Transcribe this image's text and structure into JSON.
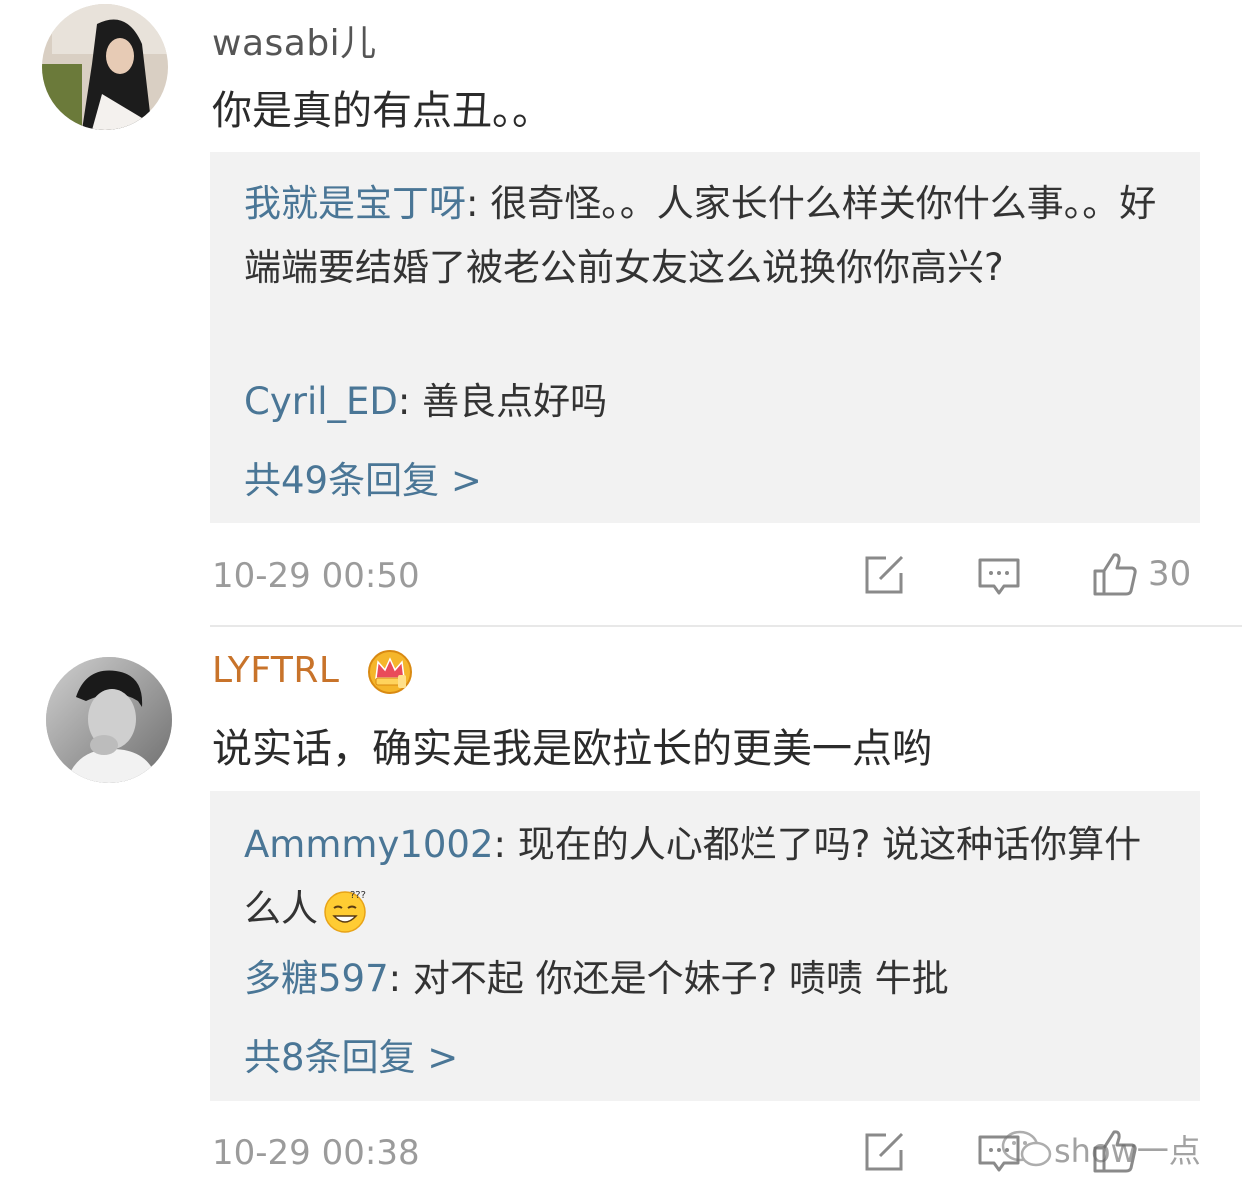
{
  "comments": [
    {
      "username": "wasabi儿",
      "text": "你是真的有点丑。。",
      "avatar_icon": "avatar-woman-photo",
      "replies": [
        {
          "name": "我就是宝丁呀",
          "text": ": 很奇怪。。人家长什么样关你什么事。。好端端要结婚了被老公前女友这么说换你你高兴?"
        },
        {
          "name": "Cyril_ED",
          "text": ": 善良点好吗"
        }
      ],
      "more_replies": "共49条回复 >",
      "time": "10-29 00:50",
      "like_count": "30"
    },
    {
      "username": "LYFTRL",
      "text": "说实话，确实是我是欧拉长的更美一点哟",
      "avatar_icon": "avatar-man-photo",
      "badge_icon": "crown-badge-icon",
      "replies": [
        {
          "name": "Ammmy1002",
          "text": ": 现在的人心都烂了吗? 说这种话你算什么人",
          "emoji": "sweat-smile-emoji-icon"
        },
        {
          "name": "多糖597",
          "text": ": 对不起 你还是个妹子?  啧啧 牛批"
        }
      ],
      "more_replies": "共8条回复 >",
      "time": "10-29 00:38",
      "like_count": ""
    }
  ],
  "watermark": "show一点",
  "colors": {
    "link": "#4a7696",
    "username_vip": "#c8732a",
    "username": "#555555",
    "meta": "#9b9b9b",
    "reply_bg": "#f2f2f2"
  }
}
